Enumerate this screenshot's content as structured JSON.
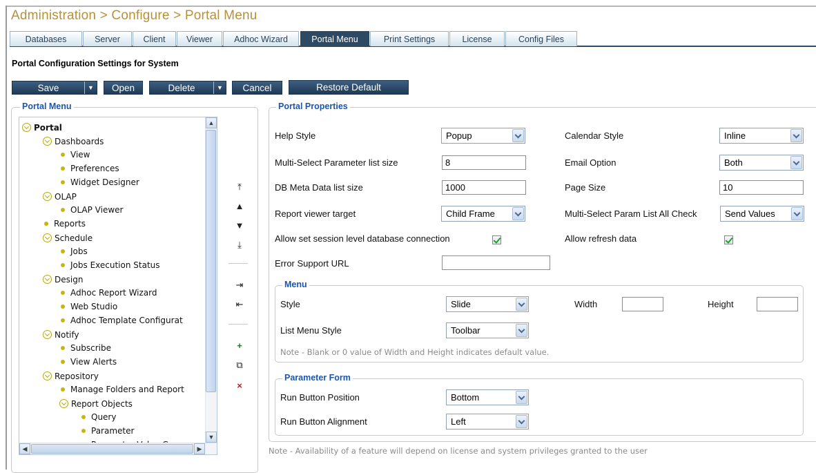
{
  "header": {
    "title": "Administration > Configure > Portal Menu"
  },
  "tabs": [
    "Databases",
    "Server",
    "Client",
    "Viewer",
    "Adhoc Wizard",
    "Portal Menu",
    "Print Settings",
    "License",
    "Config Files"
  ],
  "active_tab": "Portal Menu",
  "subtitle": "Portal Configuration Settings for System",
  "toolbar": {
    "save": "Save",
    "open": "Open",
    "delete": "Delete",
    "cancel": "Cancel",
    "restore": "Restore Default"
  },
  "portal_menu": {
    "legend": "Portal Menu",
    "tree": [
      {
        "label": "Portal",
        "type": "folder",
        "level": 0,
        "bold": true
      },
      {
        "label": "Dashboards",
        "type": "folder",
        "level": 1
      },
      {
        "label": "View",
        "type": "leaf",
        "level": 2
      },
      {
        "label": "Preferences",
        "type": "leaf",
        "level": 2
      },
      {
        "label": "Widget Designer",
        "type": "leaf",
        "level": 2
      },
      {
        "label": "OLAP",
        "type": "folder",
        "level": 1
      },
      {
        "label": "OLAP Viewer",
        "type": "leaf",
        "level": 2
      },
      {
        "label": "Reports",
        "type": "leaf",
        "level": 1
      },
      {
        "label": "Schedule",
        "type": "folder",
        "level": 1
      },
      {
        "label": "Jobs",
        "type": "leaf",
        "level": 2
      },
      {
        "label": "Jobs Execution Status",
        "type": "leaf",
        "level": 2
      },
      {
        "label": "Design",
        "type": "folder",
        "level": 1
      },
      {
        "label": "Adhoc Report Wizard",
        "type": "leaf",
        "level": 2
      },
      {
        "label": "Web Studio",
        "type": "leaf",
        "level": 2
      },
      {
        "label": "Adhoc Template Configurat",
        "type": "leaf",
        "level": 2
      },
      {
        "label": "Notify",
        "type": "folder",
        "level": 1
      },
      {
        "label": "Subscribe",
        "type": "leaf",
        "level": 2
      },
      {
        "label": "View Alerts",
        "type": "leaf",
        "level": 2
      },
      {
        "label": "Repository",
        "type": "folder",
        "level": 1
      },
      {
        "label": "Manage Folders and Report",
        "type": "leaf",
        "level": 2
      },
      {
        "label": "Report Objects",
        "type": "folder",
        "level": 2
      },
      {
        "label": "Query",
        "type": "leaf",
        "level": 3
      },
      {
        "label": "Parameter",
        "type": "leaf",
        "level": 3
      },
      {
        "label": "Parameter Value Group",
        "type": "leaf",
        "level": 3
      }
    ]
  },
  "properties": {
    "legend": "Portal Properties",
    "help_style": {
      "label": "Help Style",
      "value": "Popup"
    },
    "calendar_style": {
      "label": "Calendar Style",
      "value": "Inline"
    },
    "multi_select_size": {
      "label": "Multi-Select Parameter list size",
      "value": "8"
    },
    "email_option": {
      "label": "Email Option",
      "value": "Both"
    },
    "db_meta_size": {
      "label": "DB Meta Data list size",
      "value": "1000"
    },
    "page_size": {
      "label": "Page Size",
      "value": "10"
    },
    "report_viewer_target": {
      "label": "Report viewer target",
      "value": "Child Frame"
    },
    "multi_select_all_check": {
      "label": "Multi-Select Param List All Check",
      "value": "Send Values"
    },
    "session_db_conn": {
      "label": "Allow set session level database connection",
      "checked": true
    },
    "refresh_data": {
      "label": "Allow refresh data",
      "checked": true
    },
    "error_support_url": {
      "label": "Error Support URL",
      "value": ""
    }
  },
  "menu": {
    "legend": "Menu",
    "style": {
      "label": "Style",
      "value": "Slide"
    },
    "width": {
      "label": "Width",
      "value": ""
    },
    "height": {
      "label": "Height",
      "value": ""
    },
    "list_menu_style": {
      "label": "List Menu Style",
      "value": "Toolbar"
    },
    "note": "Note - Blank or 0 value of Width and Height indicates default value."
  },
  "parameter_form": {
    "legend": "Parameter Form",
    "run_button_position": {
      "label": "Run Button Position",
      "value": "Bottom"
    },
    "run_button_alignment": {
      "label": "Run Button Alignment",
      "value": "Left"
    }
  },
  "footer_note": "Note - Availability of a feature will depend on license and system privileges granted to the user"
}
